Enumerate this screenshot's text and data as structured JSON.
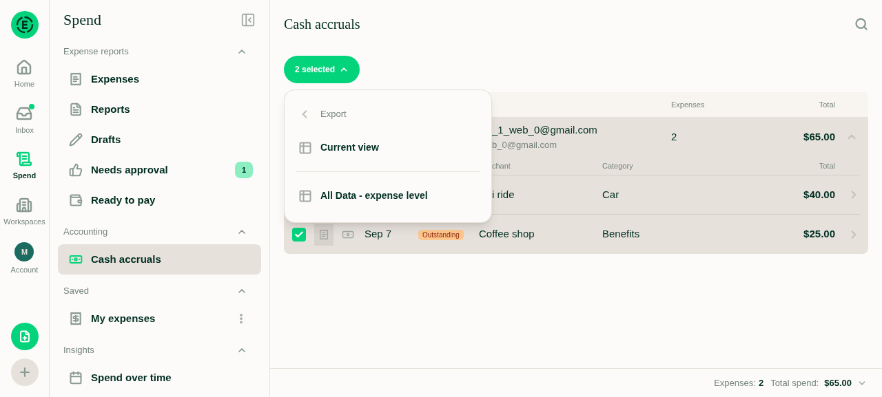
{
  "rail": {
    "items": [
      {
        "kind": "home",
        "label": "Home",
        "selected": false,
        "dot": false
      },
      {
        "kind": "inbox",
        "label": "Inbox",
        "selected": false,
        "dot": true
      },
      {
        "kind": "spend",
        "label": "Spend",
        "selected": true,
        "dot": false
      },
      {
        "kind": "workspaces",
        "label": "Workspaces",
        "selected": false,
        "dot": false
      },
      {
        "kind": "account",
        "label": "Account",
        "selected": false,
        "dot": false,
        "initial": "M"
      }
    ]
  },
  "sidebar": {
    "title": "Spend",
    "sections": [
      {
        "title": "Expense reports",
        "expanded": true,
        "items": [
          {
            "kind": "receipt",
            "label": "Expenses",
            "selected": false
          },
          {
            "kind": "document",
            "label": "Reports",
            "selected": false
          },
          {
            "kind": "pencil",
            "label": "Drafts",
            "selected": false
          },
          {
            "kind": "thumb",
            "label": "Needs approval",
            "selected": false,
            "badge": "1"
          },
          {
            "kind": "moneybag",
            "label": "Ready to pay",
            "selected": false
          }
        ]
      },
      {
        "title": "Accounting",
        "expanded": true,
        "items": [
          {
            "kind": "cash",
            "label": "Cash accruals",
            "selected": true
          }
        ]
      },
      {
        "title": "Saved",
        "expanded": true,
        "items": [
          {
            "kind": "saved",
            "label": "My expenses",
            "selected": false,
            "menu": true
          }
        ]
      },
      {
        "title": "Insights",
        "expanded": true,
        "items": [
          {
            "kind": "calendar",
            "label": "Spend over time",
            "selected": false
          }
        ]
      }
    ]
  },
  "main": {
    "title": "Cash accruals",
    "selection_button": "2 selected",
    "table": {
      "columns": {
        "expenses": "Expenses",
        "total": "Total"
      },
      "group": {
        "email": "_1_web_0@gmail.com",
        "email_sub": "b_0@gmail.com",
        "count": "2",
        "total": "$65.00",
        "expanded": true,
        "subcolumns": {
          "merchant": "chant",
          "category": "Category",
          "total": "Total"
        },
        "rows": [
          {
            "merchant": "i ride",
            "category": "Car",
            "total": "$40.00"
          },
          {
            "checked": true,
            "date": "Sep 7",
            "status": "Outstanding",
            "merchant": "Coffee shop",
            "category": "Benefits",
            "total": "$25.00"
          }
        ]
      }
    },
    "menu": {
      "title": "Export",
      "items": [
        {
          "label": "Current view"
        },
        {
          "label": "All Data - expense level"
        }
      ]
    },
    "footer": {
      "expenses_label": "Expenses:",
      "expenses_value": "2",
      "total_label": "Total spend:",
      "total_value": "$65.00"
    }
  }
}
